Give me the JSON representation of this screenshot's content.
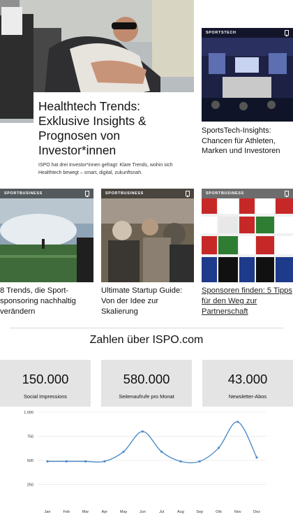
{
  "hero": {
    "title": "Healthtech Trends: Exklusive Insights & Prognosen von Investor*innen",
    "description": "ISPO hat drei Investor*innen gefragt: Klare Trends, wohin sich Healthtech bewegt – smart, digital, zukunftsnah."
  },
  "right_card": {
    "tag": "SPORTSTECH",
    "title": "SportsTech-Insights: Chancen für Athleten, Marken und Investoren"
  },
  "cards": [
    {
      "tag": "SPORTBUSINESS",
      "title": "8 Trends, die Sport-sponsoring nachhaltig verändern"
    },
    {
      "tag": "SPORTBUSINESS",
      "title": "Ultimate Startup Guide: Von der Idee zur Skalierung"
    },
    {
      "tag": "SPORTBUSINESS",
      "title": "Sponsoren finden: 5 Tipps für den Weg zur Partnerschaft"
    }
  ],
  "stats": {
    "heading": "Zahlen über ISPO.com",
    "items": [
      {
        "value": "150.000",
        "label": "Social Impressions"
      },
      {
        "value": "580.000",
        "label": "Seitenaufrufe pro Monat"
      },
      {
        "value": "43.000",
        "label": "Newsletter-Abos"
      }
    ]
  },
  "colors": {
    "line": "#4f8cc9",
    "stat_bg": "#e4e4e4",
    "grid": "#dcdcdc"
  },
  "icons": [
    "bookmark-icon"
  ],
  "chart_data": {
    "type": "line",
    "categories": [
      "Jan",
      "Feb",
      "Mar",
      "Apr",
      "May",
      "Jun",
      "Jul",
      "Aug",
      "Sep",
      "Okt",
      "Nov",
      "Dez"
    ],
    "series": [
      {
        "values": [
          490,
          490,
          490,
          490,
          590,
          800,
          590,
          490,
          490,
          630,
          900,
          530
        ]
      }
    ],
    "yticks": [
      "1.000",
      "750",
      "500",
      "250"
    ],
    "ylim": [
      250,
      1000
    ],
    "grid": true
  }
}
